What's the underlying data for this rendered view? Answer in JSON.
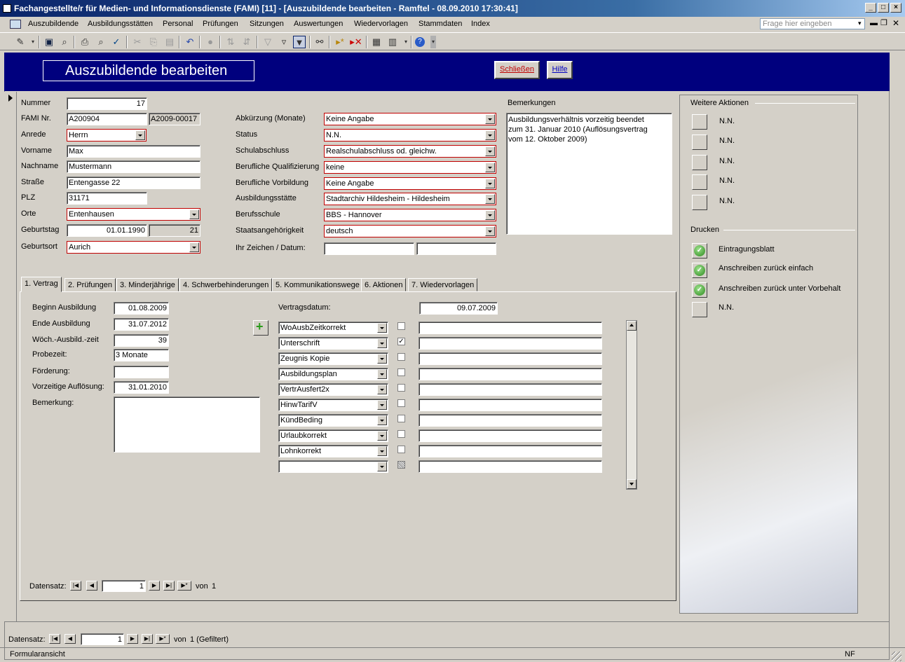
{
  "window": {
    "title": "Fachangestellte/r für Medien- und Informationsdienste (FAMI) [11] - [Auszubildende bearbeiten - Ramftel - 08.09.2010 17:30:41]"
  },
  "menu": {
    "items": [
      "Auszubildende",
      "Ausbildungsstätten",
      "Personal",
      "Prüfungen",
      "Sitzungen",
      "Auswertungen",
      "Wiedervorlagen",
      "Stammdaten",
      "Index"
    ],
    "help_placeholder": "Frage hier eingeben"
  },
  "header": {
    "title": "Auszubildende bearbeiten",
    "close_label": "Schließen",
    "help_label": "Hilfe"
  },
  "left": {
    "nummer_label": "Nummer",
    "nummer": "17",
    "fami_label": "FAMI Nr.",
    "fami": "A200904",
    "fami_code": "A2009-00017",
    "anrede_label": "Anrede",
    "anrede": "Herrn",
    "vorname_label": "Vorname",
    "vorname": "Max",
    "nachname_label": "Nachname",
    "nachname": "Mustermann",
    "strasse_label": "Straße",
    "strasse": "Entengasse 22",
    "plz_label": "PLZ",
    "plz": "31171",
    "orte_label": "Orte",
    "orte": "Entenhausen",
    "geburtstag_label": "Geburtstag",
    "geburtstag": "01.01.1990",
    "alter": "21",
    "geburtsort_label": "Geburtsort",
    "geburtsort": "Aurich"
  },
  "middle": {
    "abk_label": "Abkürzung (Monate)",
    "abk": "Keine Angabe",
    "status_label": "Status",
    "status": "N.N.",
    "schul_label": "Schulabschluss",
    "schul": "Realschulabschluss od. gleichw.",
    "qual_label": "Berufliche Qualifizierung",
    "qual": "keine",
    "vorb_label": "Berufliche Vorbildung",
    "vorb": "Keine Angabe",
    "staette_label": "Ausbildungsstätte",
    "staette": "Stadtarchiv Hildesheim - Hildesheim",
    "berufsschule_label": "Berufsschule",
    "berufsschule": "BBS - Hannover",
    "staat_label": "Staatsangehörigkeit",
    "staat": "deutsch",
    "zeichen_label": "Ihr Zeichen / Datum:",
    "zeichen": "",
    "zeichen_datum": ""
  },
  "remarks": {
    "label": "Bemerkungen",
    "text": "Ausbildungsverhältnis vorzeitig beendet\nzum 31. Januar 2010 (Auflösungsvertrag\nvom 12. Oktober 2009)"
  },
  "tabs": [
    "1. Vertrag",
    "2. Prüfungen",
    "3. Minderjährige",
    "4. Schwerbehinderungen",
    "5. Kommunikationswege",
    "6. Aktionen",
    "7. Wiedervorlagen"
  ],
  "vertrag": {
    "beginn_label": "Beginn Ausbildung",
    "beginn": "01.08.2009",
    "ende_label": "Ende Ausbildung",
    "ende": "31.07.2012",
    "woch_label": "Wöch.-Ausbild.-zeit",
    "woch": "39",
    "probe_label": "Probezeit:",
    "probe": "3 Monate",
    "foerd_label": "Förderung:",
    "foerd": "",
    "aufl_label": "Vorzeitige Auflösung:",
    "aufl": "31.01.2010",
    "bem_label": "Bemerkung:",
    "bem": "",
    "vdatum_label": "Vertragsdatum:",
    "vdatum": "09.07.2009",
    "docs": [
      {
        "name": "WoAusbZeitkorrekt",
        "checked": ""
      },
      {
        "name": "Unterschrift",
        "checked": "✓"
      },
      {
        "name": "Zeugnis Kopie",
        "checked": ""
      },
      {
        "name": "Ausbildungsplan",
        "checked": ""
      },
      {
        "name": "VertrAusfert2x",
        "checked": ""
      },
      {
        "name": "HinwTarifV",
        "checked": ""
      },
      {
        "name": "KündBeding",
        "checked": ""
      },
      {
        "name": "Urlaubkorrekt",
        "checked": ""
      },
      {
        "name": "Lohnkorrekt",
        "checked": ""
      },
      {
        "name": "",
        "checked": ""
      }
    ],
    "nav_label": "Datensatz:",
    "nav_value": "1",
    "nav_of": "von",
    "nav_total": "1"
  },
  "side": {
    "weitere_label": "Weitere Aktionen",
    "weitere": [
      "N.N.",
      "N.N.",
      "N.N.",
      "N.N.",
      "N.N."
    ],
    "drucken_label": "Drucken",
    "drucken": [
      "Eintragungsblatt",
      "Anschreiben zurück einfach",
      "Anschreiben zurück unter Vorbehalt",
      "N.N."
    ]
  },
  "footer": {
    "nav_label": "Datensatz:",
    "nav_value": "1",
    "nav_of": "von",
    "nav_total": "1 (Gefiltert)",
    "status_text": "Formularansicht",
    "status_right": "NF"
  }
}
